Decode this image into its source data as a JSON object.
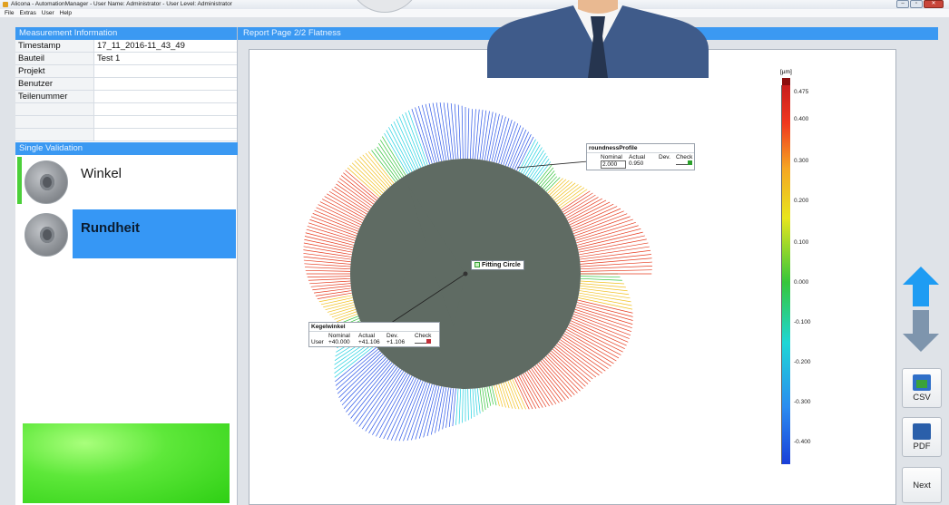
{
  "window": {
    "title": "Alicona - AutomationManager - User Name: Administrator - User Level: Administrator",
    "buttons": {
      "minimize": "–",
      "maximize": "▫",
      "close": "✕"
    }
  },
  "menu": [
    "File",
    "Extras",
    "User",
    "Help"
  ],
  "measurement": {
    "header": "Measurement Information",
    "rows": [
      {
        "key": "Timestamp",
        "value": "17_11_2016-11_43_49"
      },
      {
        "key": "Bauteil",
        "value": "Test 1"
      },
      {
        "key": "Projekt",
        "value": ""
      },
      {
        "key": "Benutzer",
        "value": ""
      },
      {
        "key": "Teilenummer",
        "value": ""
      },
      {
        "key": "",
        "value": ""
      },
      {
        "key": "",
        "value": ""
      },
      {
        "key": "",
        "value": ""
      }
    ]
  },
  "validation": {
    "header": "Single Validation",
    "items": [
      {
        "label": "Winkel",
        "status_color": "#4cd03a",
        "selected": false
      },
      {
        "label": "Rundheit",
        "status_color": "#3697f5",
        "selected": true
      }
    ]
  },
  "report": {
    "header": "Report Page 2/2  Flatness",
    "fitting_circle_label": "Fitting Circle",
    "roundness": {
      "title": "roundnessProfile",
      "cols": [
        "",
        "Nominal",
        "Actual",
        "Dev.",
        "Check"
      ],
      "row": [
        "",
        "2.000",
        "0.950",
        "",
        ""
      ]
    },
    "kegel": {
      "title": "Kegelwinkel",
      "cols": [
        "",
        "Nominal",
        "Actual",
        "Dev.",
        "Check"
      ],
      "row": [
        "User",
        "+40.000",
        "+41.106",
        "+1.106",
        ""
      ]
    },
    "scale": {
      "unit": "[µm]",
      "ticks": [
        "0.475",
        "0.400",
        "0.300",
        "0.200",
        "0.100",
        "0.000",
        "-0.100",
        "-0.200",
        "-0.300",
        "-0.400"
      ]
    }
  },
  "side": {
    "up_icon": "arrow-up-icon",
    "down_icon": "arrow-down-icon",
    "csv_label": "CSV",
    "pdf_label": "PDF",
    "next_label": "Next"
  }
}
